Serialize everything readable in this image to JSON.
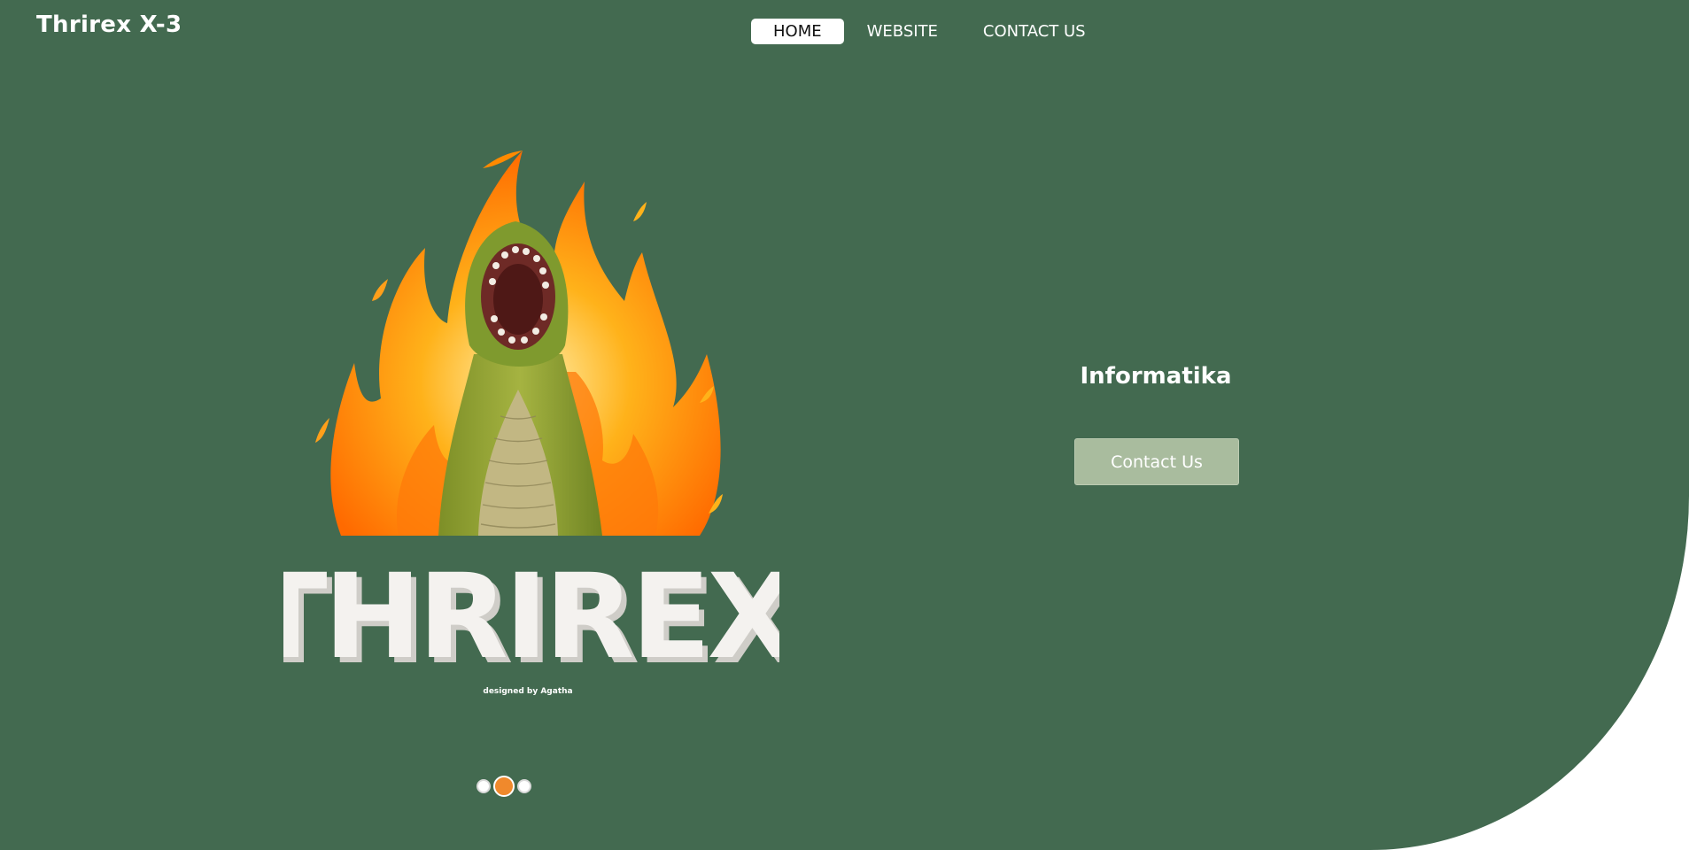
{
  "header": {
    "brand": "Thrirex X-3",
    "nav": [
      {
        "label": "HOME",
        "active": true
      },
      {
        "label": "WEBSITE",
        "active": false
      },
      {
        "label": "CONTACT US",
        "active": false
      }
    ]
  },
  "hero": {
    "logo_text": "THRIREX",
    "logo_credit": "designed by Agatha",
    "title": "Informatika",
    "cta_label": "Contact Us"
  },
  "carousel": {
    "active_index": 2
  },
  "colors": {
    "background": "#436a50",
    "button": "#a9bc9e",
    "accent": "#f0892c"
  }
}
